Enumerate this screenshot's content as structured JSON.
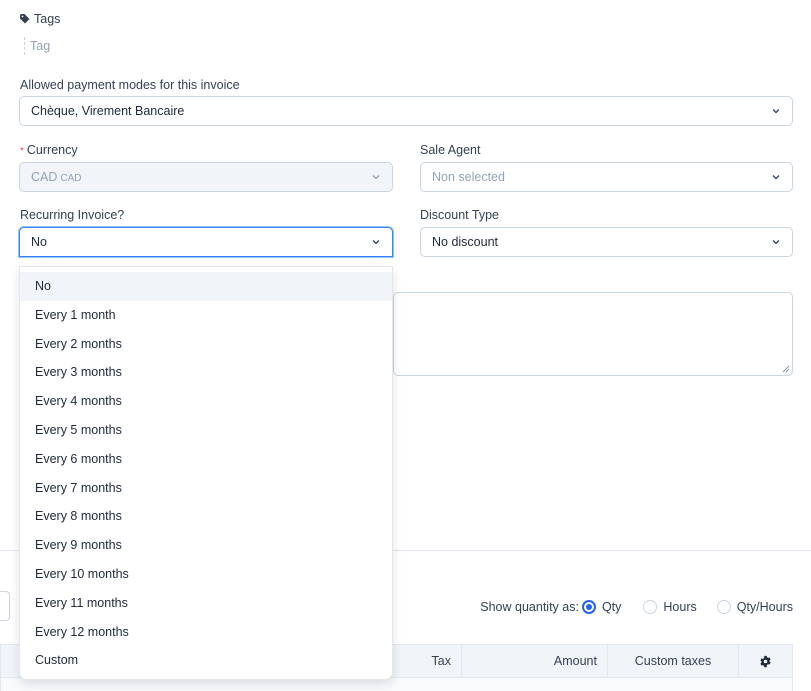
{
  "tags": {
    "label": "Tags",
    "placeholder": "Tag"
  },
  "payment_modes": {
    "label": "Allowed payment modes for this invoice",
    "value": "Chèque, Virement Bancaire"
  },
  "currency": {
    "required_mark": "*",
    "label": "Currency",
    "value": "CAD",
    "value_sub": "CAD"
  },
  "sale_agent": {
    "label": "Sale Agent",
    "placeholder": "Non selected"
  },
  "recurring": {
    "label": "Recurring Invoice?",
    "value": "No",
    "options": [
      "No",
      "Every 1 month",
      "Every 2 months",
      "Every 3 months",
      "Every 4 months",
      "Every 5 months",
      "Every 6 months",
      "Every 7 months",
      "Every 8 months",
      "Every 9 months",
      "Every 10 months",
      "Every 11 months",
      "Every 12 months",
      "Custom"
    ],
    "highlighted_index": 0
  },
  "discount_type": {
    "label": "Discount Type",
    "value": "No discount"
  },
  "quantity": {
    "label": "Show quantity as:",
    "options": [
      "Qty",
      "Hours",
      "Qty/Hours"
    ],
    "selected": "Qty"
  },
  "table": {
    "columns": [
      "Tax",
      "Amount",
      "Custom taxes"
    ],
    "settings_icon": "gear-icon"
  },
  "colors": {
    "accent": "#2563eb",
    "required": "#ef4444",
    "header_bg": "#f1f5f9"
  }
}
